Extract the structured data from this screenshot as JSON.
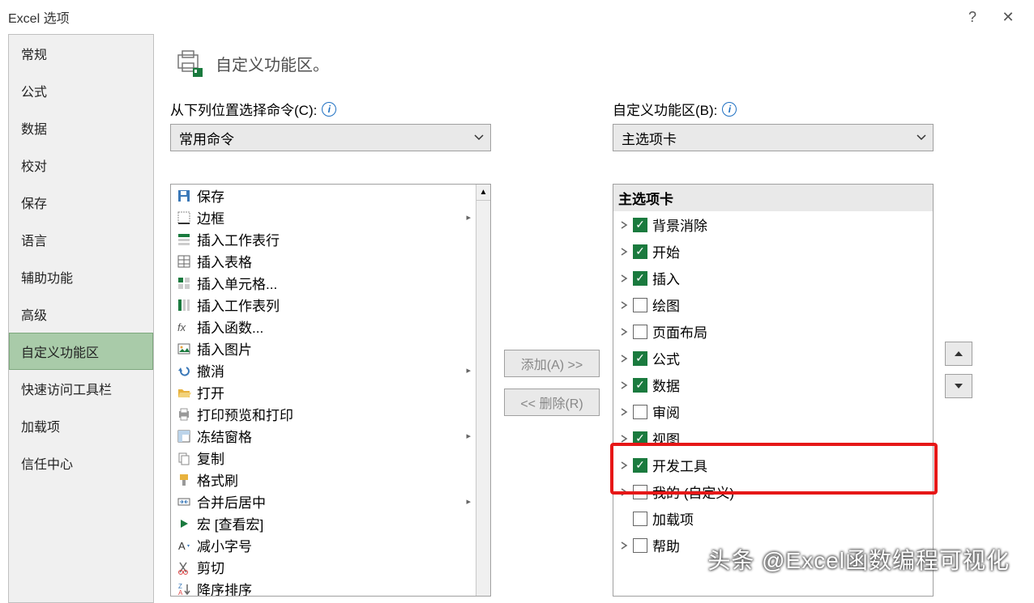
{
  "titlebar": {
    "title": "Excel 选项"
  },
  "sidebar": {
    "items": [
      {
        "label": "常规"
      },
      {
        "label": "公式"
      },
      {
        "label": "数据"
      },
      {
        "label": "校对"
      },
      {
        "label": "保存"
      },
      {
        "label": "语言"
      },
      {
        "label": "辅助功能"
      },
      {
        "label": "高级"
      },
      {
        "label": "自定义功能区",
        "selected": true
      },
      {
        "label": "快速访问工具栏"
      },
      {
        "label": "加载项"
      },
      {
        "label": "信任中心"
      }
    ]
  },
  "section_title": "自定义功能区。",
  "left": {
    "label": "从下列位置选择命令(C):",
    "combo": "常用命令",
    "items": [
      {
        "icon": "save",
        "label": "保存"
      },
      {
        "icon": "border",
        "label": "边框",
        "exp": true
      },
      {
        "icon": "insertrow",
        "label": "插入工作表行"
      },
      {
        "icon": "inserttable",
        "label": "插入表格"
      },
      {
        "icon": "insertcell",
        "label": "插入单元格..."
      },
      {
        "icon": "insertcol",
        "label": "插入工作表列"
      },
      {
        "icon": "fx",
        "label": "插入函数..."
      },
      {
        "icon": "insertpic",
        "label": "插入图片"
      },
      {
        "icon": "undo",
        "label": "撤消",
        "exp": true
      },
      {
        "icon": "open",
        "label": "打开"
      },
      {
        "icon": "printprev",
        "label": "打印预览和打印"
      },
      {
        "icon": "freeze",
        "label": "冻结窗格",
        "exp": true
      },
      {
        "icon": "copy",
        "label": "复制"
      },
      {
        "icon": "formatp",
        "label": "格式刷"
      },
      {
        "icon": "merge",
        "label": "合并后居中",
        "exp": true
      },
      {
        "icon": "macro",
        "label": "宏 [查看宏]"
      },
      {
        "icon": "fontdn",
        "label": "减小字号"
      },
      {
        "icon": "cut",
        "label": "剪切"
      },
      {
        "icon": "sortdesc",
        "label": "降序排序"
      }
    ]
  },
  "middle": {
    "add": "添加(A) >>",
    "remove": "<< 删除(R)"
  },
  "right": {
    "label": "自定义功能区(B):",
    "combo": "主选项卡",
    "header": "主选项卡",
    "items": [
      {
        "label": "背景消除",
        "checked": true
      },
      {
        "label": "开始",
        "checked": true
      },
      {
        "label": "插入",
        "checked": true
      },
      {
        "label": "绘图",
        "checked": false
      },
      {
        "label": "页面布局",
        "checked": false
      },
      {
        "label": "公式",
        "checked": true
      },
      {
        "label": "数据",
        "checked": true
      },
      {
        "label": "审阅",
        "checked": false
      },
      {
        "label": "视图",
        "checked": true
      },
      {
        "label": "开发工具",
        "checked": true,
        "highlighted": true
      },
      {
        "label": "我的 (自定义)",
        "checked": false
      },
      {
        "label": "加载项",
        "checked": false,
        "nochev": true
      },
      {
        "label": "帮助",
        "checked": false
      }
    ]
  },
  "watermark": "头条 @Excel函数编程可视化"
}
